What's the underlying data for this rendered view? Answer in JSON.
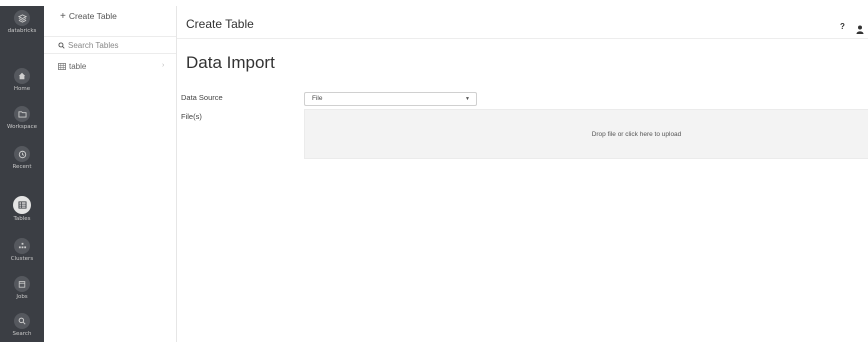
{
  "nav": {
    "items": [
      {
        "label": "databricks",
        "icon": "layers-icon"
      },
      {
        "label": "Home",
        "icon": "home-icon"
      },
      {
        "label": "Workspace",
        "icon": "folder-icon"
      },
      {
        "label": "Recent",
        "icon": "clock-icon"
      },
      {
        "label": "Tables",
        "icon": "table-icon"
      },
      {
        "label": "Clusters",
        "icon": "clusters-icon"
      },
      {
        "label": "Jobs",
        "icon": "calendar-icon"
      },
      {
        "label": "Search",
        "icon": "search-icon"
      }
    ]
  },
  "panel": {
    "create_label": "Create Table",
    "search_placeholder": "Search Tables",
    "items": [
      {
        "label": "table"
      }
    ]
  },
  "header": {
    "title": "Create Table",
    "help_label": "?"
  },
  "main": {
    "heading": "Data Import",
    "data_source_label": "Data Source",
    "data_source_value": "File",
    "files_label": "File(s)",
    "dropzone_text": "Drop file or click here to upload"
  }
}
